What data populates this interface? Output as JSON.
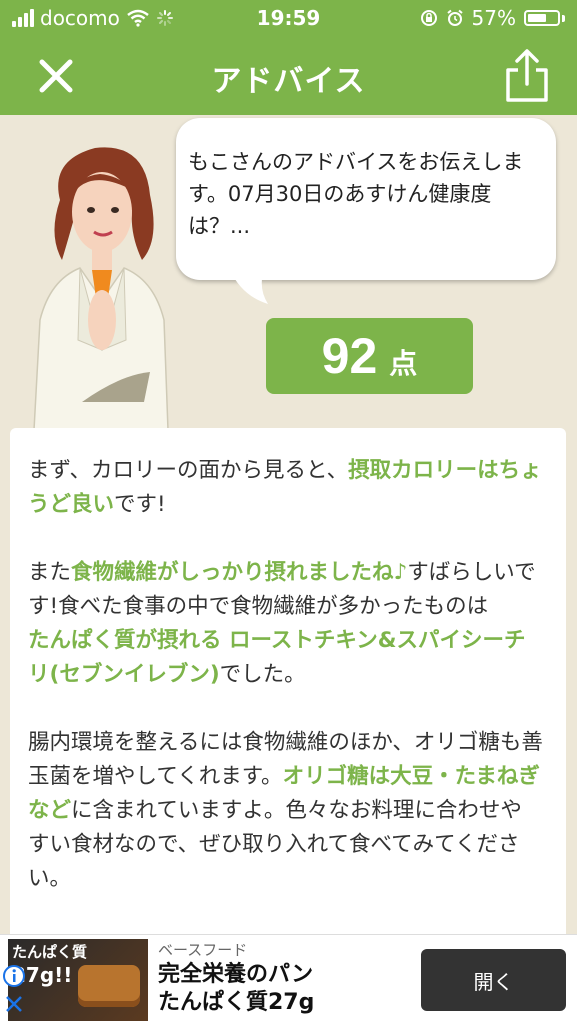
{
  "status_bar": {
    "carrier": "docomo",
    "time": "19:59",
    "battery_percent": "57%"
  },
  "header": {
    "title": "アドバイス",
    "close_icon": "close-icon",
    "share_icon": "share-icon",
    "accent_color": "#7db44a"
  },
  "advisor": {
    "bubble_text": "もこさんのアドバイスをお伝えします。07月30日のあすけん健康度は？..."
  },
  "score": {
    "value": "92",
    "unit": "点"
  },
  "advice": {
    "p1": {
      "t1": "まず、カロリーの面から見ると、",
      "h1": "摂取カロリーはちょうど良い",
      "t2": "です!"
    },
    "p2": {
      "t1": "また",
      "h1": "食物繊維がしっかり摂れましたね♪",
      "t2": "すばらしいです!食べた食事の中で食物繊維が多かったものは",
      "h2": "たんぱく質が摂れる ローストチキン&スパイシーチリ(セブンイレブン)",
      "t3": "でした。"
    },
    "p3": {
      "t1": "腸内環境を整えるには食物繊維のほか、オリゴ糖も善玉菌を増やしてくれます。",
      "h1": "オリゴ糖は大豆・たまねぎなど",
      "t2": "に含まれていますよ。色々なお料理に合わせやすい食材なので、ぜひ取り入れて食べてみてください。"
    }
  },
  "ad": {
    "thumb_small": "たんぱく質",
    "thumb_big": "27g!!",
    "advertiser": "ベースフード",
    "headline_line1": "完全栄養のパン",
    "headline_line2": "たんぱく質27g",
    "button_label": "開く"
  }
}
